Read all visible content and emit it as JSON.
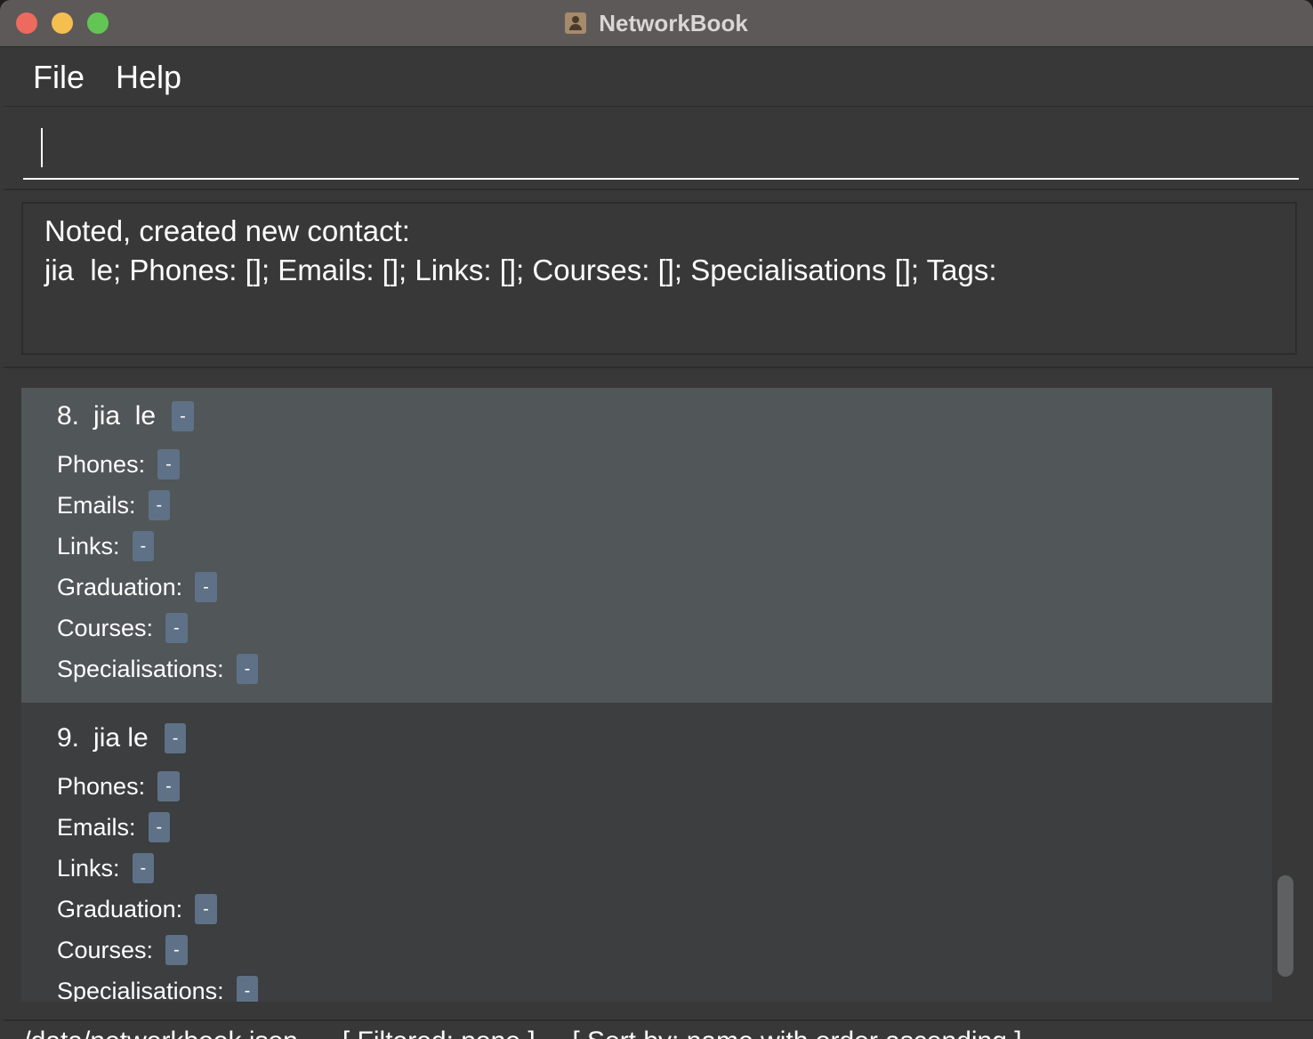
{
  "window": {
    "title": "NetworkBook"
  },
  "menu": {
    "file": "File",
    "help": "Help"
  },
  "command": {
    "value": ""
  },
  "result": {
    "line1": "Noted, created new contact:",
    "line2": "jia  le; Phones: []; Emails: []; Links: []; Courses: []; Specialisations []; Tags:"
  },
  "contacts": [
    {
      "index": "8.",
      "name": "jia  le",
      "name_tag": "-",
      "fields": [
        {
          "label": "Phones:",
          "value": "-"
        },
        {
          "label": "Emails:",
          "value": "-"
        },
        {
          "label": "Links:",
          "value": "-"
        },
        {
          "label": "Graduation:",
          "value": "-"
        },
        {
          "label": "Courses:",
          "value": "-"
        },
        {
          "label": "Specialisations:",
          "value": "-"
        }
      ]
    },
    {
      "index": "9.",
      "name": "jia le",
      "name_tag": "-",
      "fields": [
        {
          "label": "Phones:",
          "value": "-"
        },
        {
          "label": "Emails:",
          "value": "-"
        },
        {
          "label": "Links:",
          "value": "-"
        },
        {
          "label": "Graduation:",
          "value": "-"
        },
        {
          "label": "Courses:",
          "value": "-"
        },
        {
          "label": "Specialisations:",
          "value": "-"
        }
      ]
    }
  ],
  "status": {
    "text": "./data/networkbook.json      [ Filtered: none ]     [ Sort by: name with order ascending ]"
  }
}
